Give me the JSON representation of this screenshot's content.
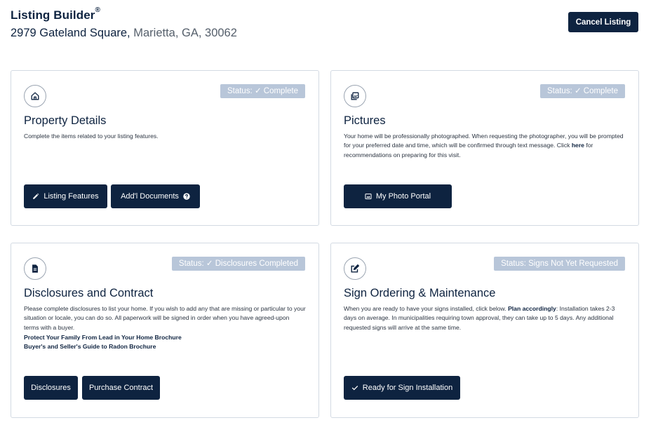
{
  "header": {
    "title": "Listing Builder",
    "title_mark": "®",
    "street": "2979 Gateland Square,",
    "city": "Marietta, GA, 30062",
    "cancel_label": "Cancel Listing"
  },
  "cards": {
    "property": {
      "icon": "home-icon",
      "status": "Status:  ✓ Complete",
      "title": "Property Details",
      "desc": "Complete the items related to your listing features.",
      "btn1": "Listing Features",
      "btn2": "Add'l Documents"
    },
    "pictures": {
      "icon": "photo-icon",
      "status": "Status:  ✓  Complete",
      "title": "Pictures",
      "desc_pre": "Your home will be professionally photographed. When requesting the photographer, you will be prompted for your preferred date and time, which will be confirmed through text message. Click ",
      "desc_link": "here",
      "desc_post": " for recommendations on preparing for this visit.",
      "btn1": "My Photo Portal"
    },
    "disclosures": {
      "icon": "document-icon",
      "status": "Status: ✓ Disclosures Completed",
      "title": "Disclosures and Contract",
      "desc": "Please complete disclosures to list your home. If you wish to add any that are missing or particular to your situation or locale, you can do so. All paperwork will be signed in order when you have agreed-upon terms with a buyer.",
      "link1": "Protect Your Family From Lead in Your Home Brochure",
      "link2": "Buyer's and Seller's Guide to Radon Brochure",
      "btn1": "Disclosures",
      "btn2": "Purchase Contract"
    },
    "signs": {
      "icon": "edit-icon",
      "status": "Status: Signs Not Yet Requested",
      "title": "Sign Ordering & Maintenance",
      "desc_pre": "When you are ready to have your signs installed, click below. ",
      "desc_bold": "Plan accordingly",
      "desc_post": ": Installation takes 2-3 days on average. In municipalities requiring town approval, they can take up to 5 days. Any additional requested signs will arrive at the same time.",
      "btn1": "Ready for Sign Installation"
    }
  },
  "colors": {
    "primary": "#0e2340",
    "status_bg": "#b8c6d9",
    "border": "#d3dae3"
  }
}
